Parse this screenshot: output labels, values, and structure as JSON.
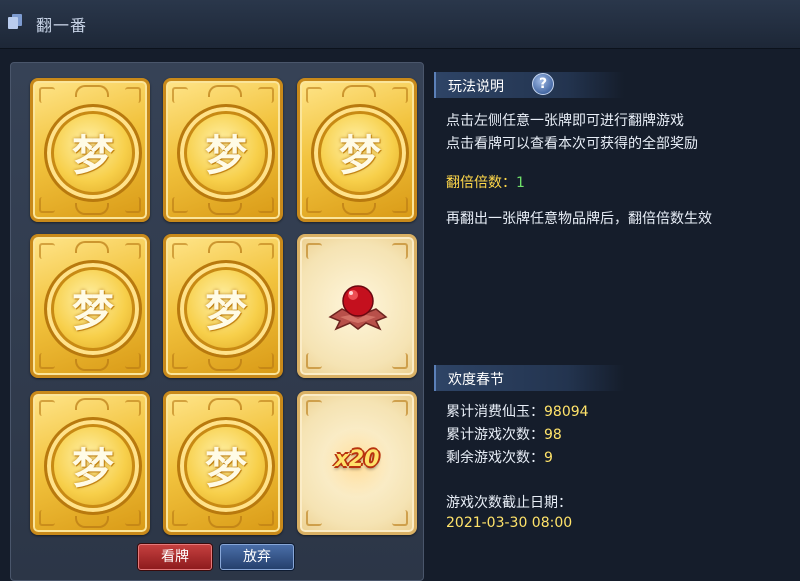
{
  "window": {
    "title": "翻一番"
  },
  "cards": [
    {
      "state": "back",
      "glyph": "梦"
    },
    {
      "state": "back",
      "glyph": "梦"
    },
    {
      "state": "back",
      "glyph": "梦"
    },
    {
      "state": "back",
      "glyph": "梦"
    },
    {
      "state": "back",
      "glyph": "梦"
    },
    {
      "state": "revealed",
      "reward_icon": "red-berry-item-icon"
    },
    {
      "state": "back",
      "glyph": "梦"
    },
    {
      "state": "back",
      "glyph": "梦"
    },
    {
      "state": "revealed",
      "reward_text": "x20"
    }
  ],
  "buttons": {
    "view_label": "看牌",
    "abandon_label": "放弃"
  },
  "rules": {
    "title": "玩法说明",
    "help_icon": "?",
    "line1": "点击左侧任意一张牌即可进行翻牌游戏",
    "line2": "点击看牌可以查看本次可获得的全部奖励",
    "multiplier_label": "翻倍倍数：",
    "multiplier_value": "1",
    "note": "再翻出一张牌任意物品牌后，翻倍倍数生效"
  },
  "event": {
    "title": "欢度春节",
    "spent_label": "累计消费仙玉：",
    "spent_value": "98094",
    "games_label": "累计游戏次数：",
    "games_value": "98",
    "remaining_label": "剩余游戏次数：",
    "remaining_value": "9",
    "deadline_label": "游戏次数截止日期：",
    "deadline_value": "2021-03-30 08:00"
  },
  "colors": {
    "highlight": "#ffd84a",
    "value": "#6fe06a",
    "view_button": "#a8282a",
    "abandon_button": "#3a5b92"
  }
}
